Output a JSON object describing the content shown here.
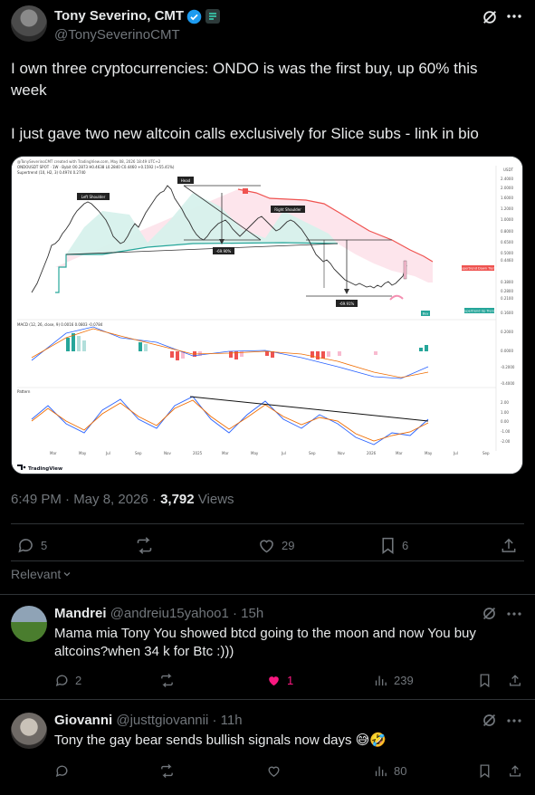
{
  "tweet": {
    "author_name": "Tony Severino, CMT",
    "author_handle": "@TonySeverinoCMT",
    "text_line1": "I own three cryptocurrencies: ONDO is was the first buy, up 60% this",
    "text_line2": "week",
    "text_line3": "I just gave two new altcoin calls exclusively for Slice subs - link in bio",
    "time": "6:49 PM · May 8, 2026 · ",
    "views_count": "3,792",
    "views_label": " Views",
    "reply_count": "5",
    "like_count": "29",
    "bookmark_count": "6"
  },
  "chart": {
    "header_line1": "@TonySeverinoCMT created with TradingView.com, May 08, 2026 18:49 UTC+2",
    "header_line2": "ONDOUSDT SPOT · 1W · Bybit  O0.2873 H0.4638 L0.2840 C0.4460 +0.1592 (+55.41%)",
    "header_line3": "Supertrend (10, H2, 3)  0.4974  0.2740",
    "label_head": "Head",
    "label_left_shoulder": "Left Shoulder",
    "label_right_shoulder": "Right Shoulder",
    "label_drop1": "-69.90%",
    "label_drop2": "-69.91%",
    "label_st_down": "Supertrend Down Trend",
    "label_st_up": "Supertrend Up Trend",
    "label_buy": "Buy",
    "macd_label": "MACD (12, 26, close, 9)  0.0016  0.0803  -0.0784",
    "pattern_label": "Pattern",
    "price_ticks": [
      "2.4000",
      "2.0000",
      "1.6000",
      "1.2000",
      "1.0000",
      "0.8000",
      "0.6500",
      "0.5000",
      "0.4460",
      "0.3800",
      "0.2800",
      "0.2100",
      "0.1600"
    ],
    "macd_ticks": [
      "0.2000",
      "0.0000",
      "-0.2000",
      "-0.4000"
    ],
    "osc_ticks": [
      "2.00",
      "1.00",
      "0.00",
      "-1.00",
      "-2.00"
    ],
    "x_ticks": [
      "Mar",
      "May",
      "Jul",
      "Sep",
      "Nov",
      "2025",
      "Mar",
      "May",
      "Jul",
      "Sep",
      "Nov",
      "2026",
      "Mar",
      "May",
      "Jul",
      "Sep"
    ],
    "currency": "USDT",
    "brand": "TradingView"
  },
  "sort_label": "Relevant",
  "replies": [
    {
      "name": "Mandrei",
      "handle": "@andreiu15yahoo1 · 15h",
      "text_line1": "Mama mia Tony You showed btcd going to the moon and now You buy",
      "text_line2": "altcoins?when 34 k for Btc :)))",
      "reply_count": "2",
      "like_count": "1",
      "view_count": "239"
    },
    {
      "name": "Giovanni",
      "handle": "@justtgiovannii · 11h",
      "text_line1": "Tony the gay bear sends bullish signals now days 😅🤣",
      "reply_count": "",
      "like_count": "",
      "view_count": "80"
    }
  ],
  "colors": {
    "verified_blue": "#1d9bf0",
    "like_pink": "#f91880",
    "chart_green": "#26a69a",
    "chart_red": "#ef5350"
  }
}
